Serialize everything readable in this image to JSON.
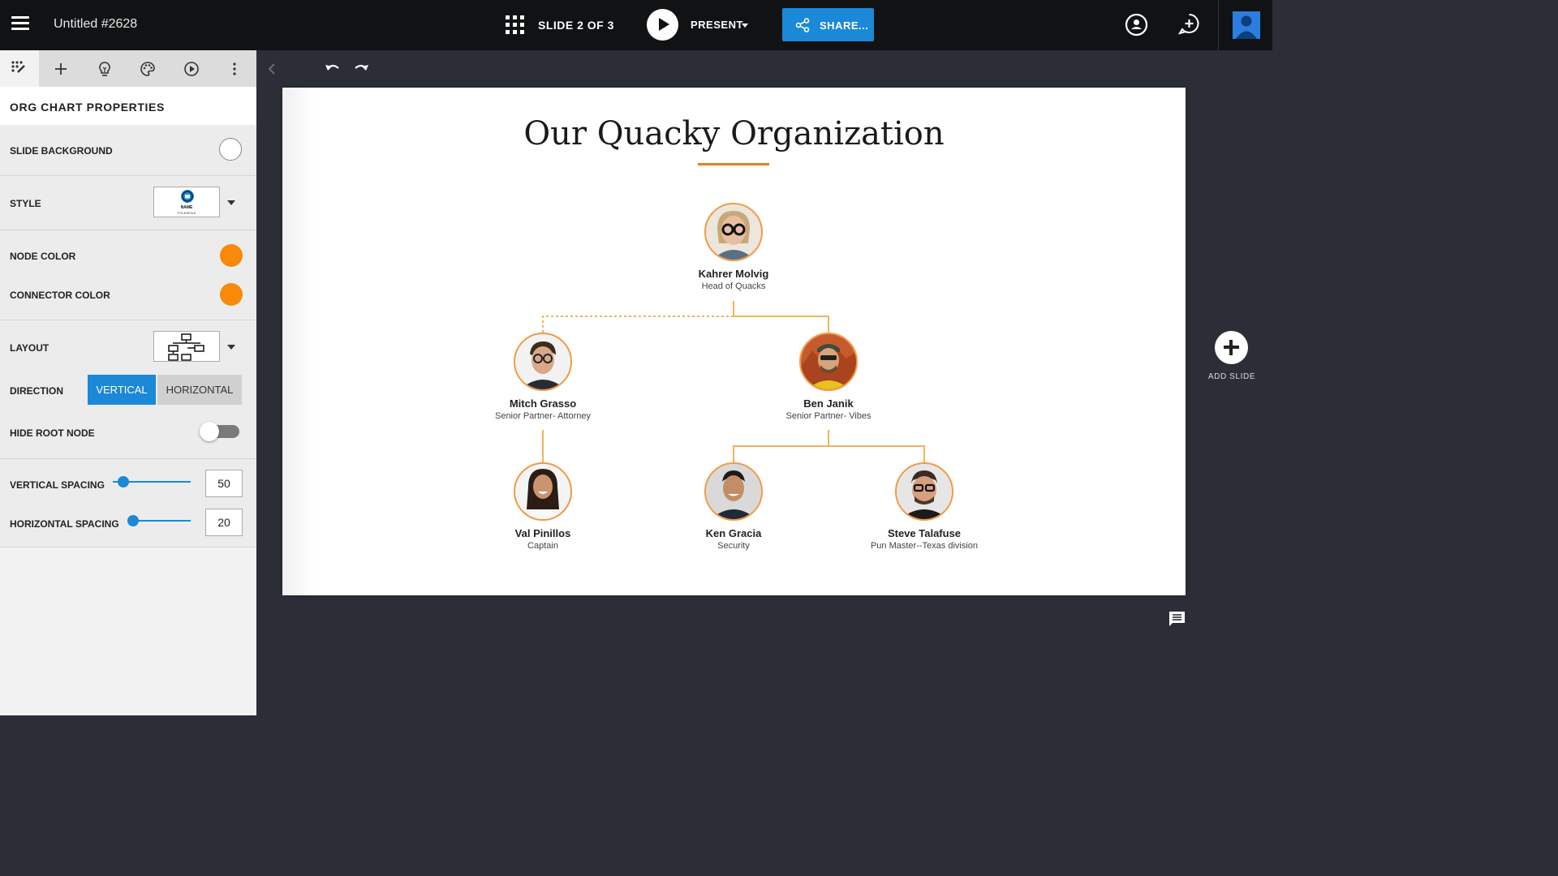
{
  "topbar": {
    "title": "Untitled #2628",
    "slide_counter": "SLIDE 2 OF 3",
    "present_label": "PRESENT",
    "share_label": "SHARE..."
  },
  "panel": {
    "heading": "ORG CHART PROPERTIES",
    "slide_background_label": "SLIDE BACKGROUND",
    "style_label": "STYLE",
    "style_thumb_name": "NAME",
    "style_thumb_role": "TITLE/ROLE",
    "node_color_label": "NODE COLOR",
    "connector_color_label": "CONNECTOR COLOR",
    "layout_label": "LAYOUT",
    "direction_label": "DIRECTION",
    "direction_vertical": "VERTICAL",
    "direction_horizontal": "HORIZONTAL",
    "hide_root_label": "HIDE ROOT NODE",
    "hide_root_on": false,
    "vertical_spacing_label": "VERTICAL SPACING",
    "vertical_spacing_value": "50",
    "horizontal_spacing_label": "HORIZONTAL SPACING",
    "horizontal_spacing_value": "20",
    "slide_background_color": "#ffffff",
    "node_color": "#f7890b",
    "connector_color": "#f7890b"
  },
  "slide": {
    "title": "Our Quacky Organization",
    "nodes": [
      {
        "name": "Kahrer Molvig",
        "role": "Head of Quacks"
      },
      {
        "name": "Mitch Grasso",
        "role": "Senior Partner- Attorney"
      },
      {
        "name": "Ben Janik",
        "role": "Senior Partner- Vibes"
      },
      {
        "name": "Val Pinillos",
        "role": "Captain"
      },
      {
        "name": "Ken Gracia",
        "role": "Security"
      },
      {
        "name": "Steve Talafuse",
        "role": "Pun Master--Texas division"
      }
    ]
  },
  "add_slide_label": "ADD SLIDE",
  "accent_color": "#1b88d8"
}
